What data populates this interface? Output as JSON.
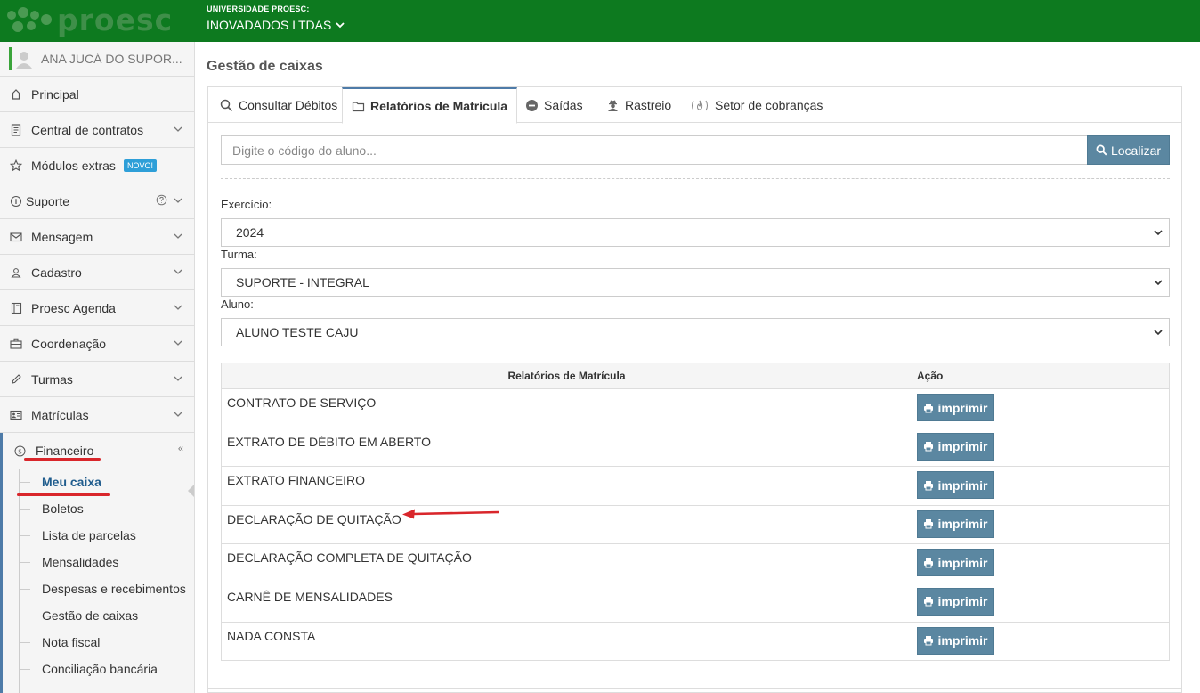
{
  "brand": {
    "logo_text": "proesc",
    "org_small": "UNIVERSIDADE PROESC:",
    "org_name": "INOVADADOS LTDAS"
  },
  "sidebar": {
    "user_name": "ANA JUCÁ DO SUPOR...",
    "items": [
      {
        "label": "Principal",
        "icon": "home-icon"
      },
      {
        "label": "Central de contratos",
        "icon": "document-icon"
      },
      {
        "label": "Módulos extras",
        "icon": "star-icon",
        "badge": "NOVO!"
      },
      {
        "label": "Suporte",
        "icon": "info-icon"
      },
      {
        "label": "Mensagem",
        "icon": "envelope-icon"
      },
      {
        "label": "Cadastro",
        "icon": "user-icon"
      },
      {
        "label": "Proesc Agenda",
        "icon": "book-icon"
      },
      {
        "label": "Coordenação",
        "icon": "briefcase-icon"
      },
      {
        "label": "Turmas",
        "icon": "pencil-icon"
      },
      {
        "label": "Matrículas",
        "icon": "id-card-icon"
      }
    ],
    "financeiro": {
      "label": "Financeiro",
      "subitems": [
        "Meu caixa",
        "Boletos",
        "Lista de parcelas",
        "Mensalidades",
        "Despesas e recebimentos",
        "Gestão de caixas",
        "Nota fiscal",
        "Conciliação bancária"
      ],
      "active_subitem": "Meu caixa"
    }
  },
  "main": {
    "title": "Gestão de caixas",
    "tabs": [
      {
        "label": "Consultar Débitos",
        "icon": "search-icon"
      },
      {
        "label": "Relatórios de Matrícula",
        "icon": "folder-icon",
        "active": true
      },
      {
        "label": "Saídas",
        "icon": "minus-circle-icon"
      },
      {
        "label": "Rastreio",
        "icon": "user-secret-icon"
      },
      {
        "label": "Setor de cobranças",
        "icon": "fire-icon"
      }
    ],
    "search": {
      "placeholder": "Digite o código do aluno...",
      "button_label": "Localizar"
    },
    "fields": {
      "exercicio_label": "Exercício:",
      "exercicio_value": "2024",
      "turma_label": "Turma:",
      "turma_value": "SUPORTE - INTEGRAL",
      "aluno_label": "Aluno:",
      "aluno_value": "ALUNO TESTE CAJU"
    },
    "table": {
      "col_report": "Relatórios de Matrícula",
      "col_action": "Ação",
      "print_label": "imprimir",
      "rows": [
        "CONTRATO DE SERVIÇO",
        "EXTRATO DE DÉBITO EM ABERTO",
        "EXTRATO FINANCEIRO",
        "DECLARAÇÃO DE QUITAÇÃO",
        "DECLARAÇÃO COMPLETA DE QUITAÇÃO",
        "CARNÊ DE MENSALIDADES",
        "NADA CONSTA"
      ]
    }
  },
  "colors": {
    "header_green": "#0d7a1f",
    "button_blue": "#5b87a1",
    "annotation_red": "#d9262b"
  }
}
